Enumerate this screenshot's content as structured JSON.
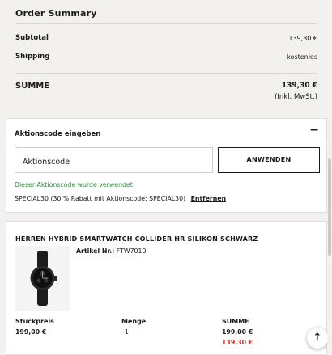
{
  "summary": {
    "title": "Order Summary",
    "subtotal_label": "Subtotal",
    "subtotal_value": "139,30 €",
    "shipping_label": "Shipping",
    "shipping_value": "kostenlos",
    "total_label": "SUMME",
    "total_value": "139,30 €",
    "total_note": "(Inkl. MwSt.)"
  },
  "promo": {
    "heading": "Aktionscode eingeben",
    "collapse_icon": "−",
    "input_value": "Aktionscode",
    "apply_label": "ANWENDEN",
    "success_message": "Dieser Aktionscode wurde verwendet!",
    "applied_code": "SPECIAL30 (30 % Rabatt mit Aktionscode: SPECIAL30)",
    "remove_label": "Entfernen"
  },
  "product": {
    "name": "HERREN HYBRID SMARTWATCH COLLIDER HR SILIKON SCHWARZ",
    "article_label": "Artikel Nr.:",
    "article_value": "FTW7010",
    "unit_price_label": "Stückpreis",
    "unit_price_value": "199,00 €",
    "quantity_label": "Menge",
    "quantity_value": "1",
    "sum_label": "SUMME",
    "sum_old": "199,00 €",
    "sum_new": "139,30 €"
  },
  "scroll_top_icon": "arrow-up-icon",
  "colors": {
    "page_bg": "#f2f1ef",
    "success": "#2e8b3a",
    "discount": "#c0392b"
  }
}
